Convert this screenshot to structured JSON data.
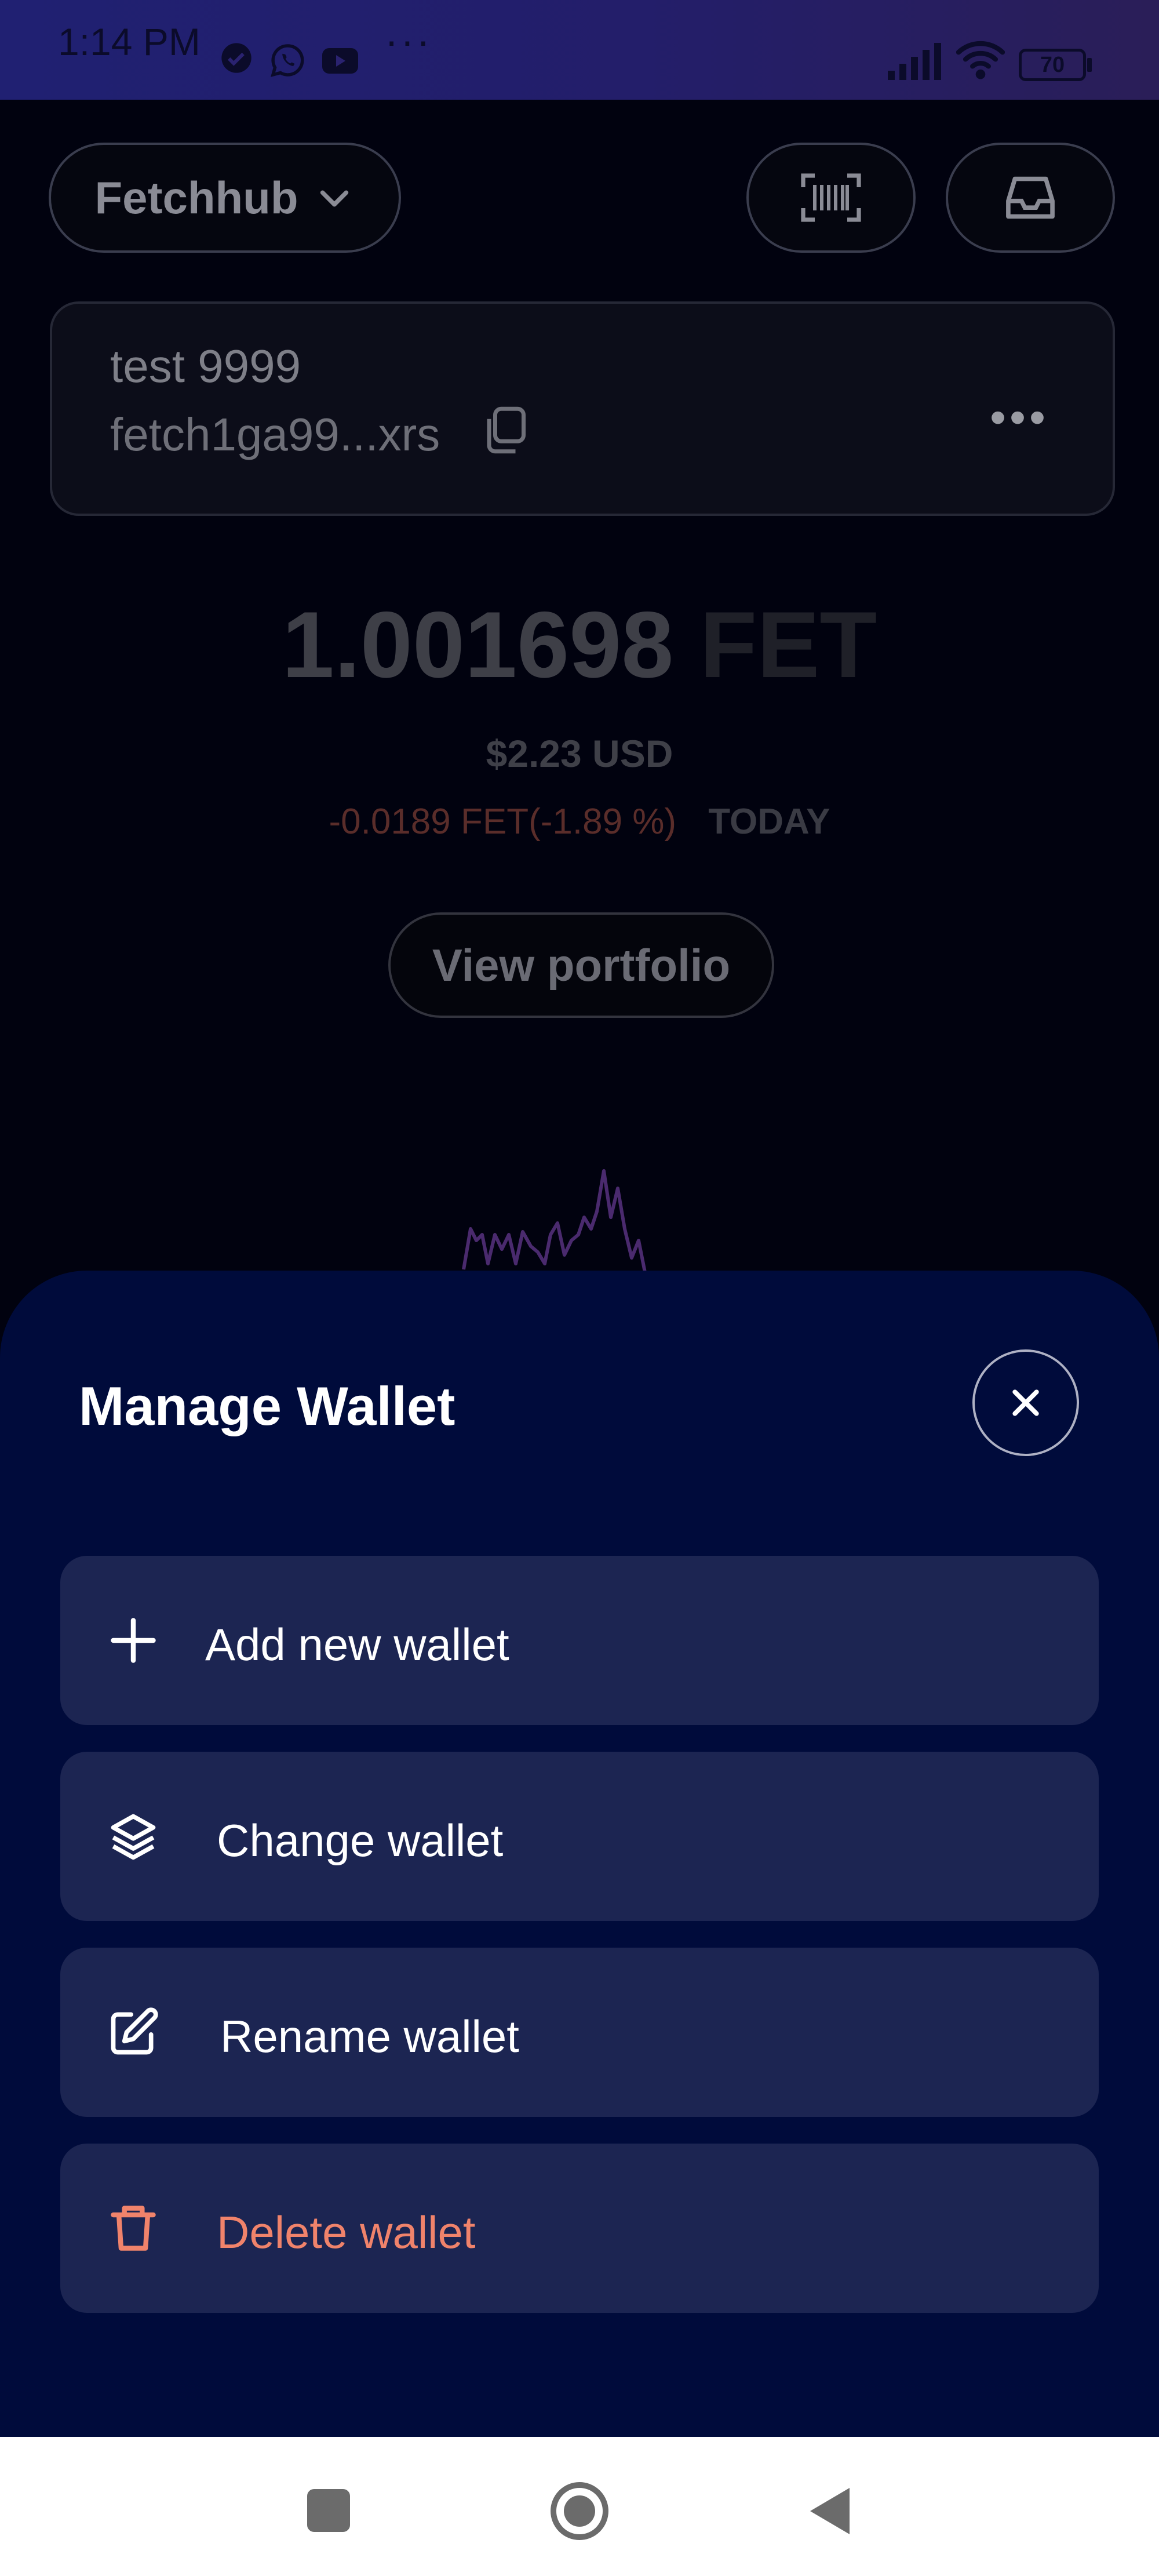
{
  "status_bar": {
    "time": "1:14 PM",
    "battery": "70",
    "overflow": "···",
    "icons": [
      "check-circle-icon",
      "whatsapp-icon",
      "youtube-icon",
      "signal-icon",
      "wifi-icon",
      "battery-icon"
    ]
  },
  "header": {
    "network_label": "Fetchhub",
    "icons": [
      "chevron-down-icon",
      "barcode-scan-icon",
      "inbox-icon"
    ]
  },
  "account": {
    "name": "test 9999",
    "address": "fetch1ga99...xrs",
    "more": "•••"
  },
  "balance": {
    "amount": "1.001698",
    "unit": "FET",
    "usd": "$2.23 USD",
    "change": "-0.0189 FET(-1.89 %)",
    "period": "TODAY"
  },
  "portfolio_button": "View portfolio",
  "sheet": {
    "title": "Manage Wallet",
    "items": [
      {
        "label": "Add new wallet",
        "icon": "plus-icon"
      },
      {
        "label": "Change wallet",
        "icon": "layers-icon"
      },
      {
        "label": "Rename wallet",
        "icon": "edit-icon"
      },
      {
        "label": "Delete wallet",
        "icon": "trash-icon"
      }
    ]
  },
  "colors": {
    "sheet_bg": "#000b3b",
    "item_bg": "#1c2552",
    "danger": "#f0836b"
  }
}
